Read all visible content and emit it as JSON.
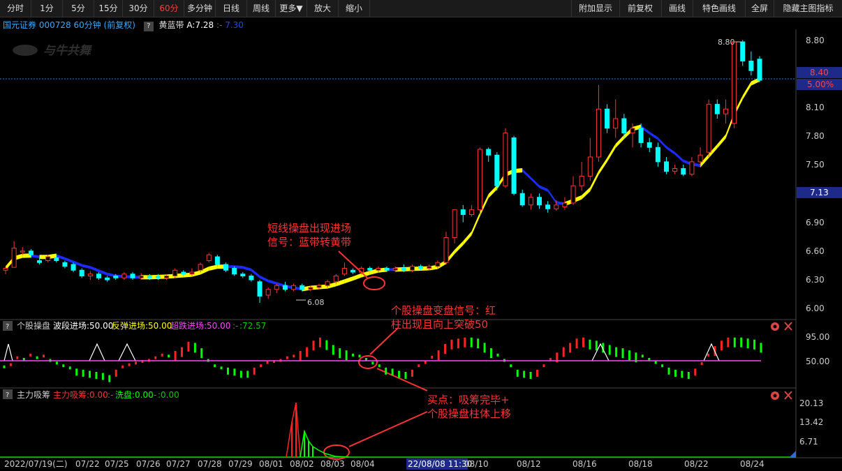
{
  "toolbar": {
    "left": [
      "分时",
      "1分",
      "5分",
      "15分",
      "30分",
      "60分",
      "多分钟",
      "日线",
      "周线",
      "更多▼",
      "放大",
      "缩小"
    ],
    "active": "60分",
    "right": [
      "附加显示",
      "前复权",
      "画线",
      "特色画线",
      "全屏",
      "隐藏主图指标"
    ]
  },
  "header": {
    "stock": "国元证券 000728 60分钟 (前复权)",
    "indicator": "黄蓝带",
    "ind_val": "A:7.28",
    "ind_dots": ":-",
    "ind_val2": "7.30"
  },
  "watermark": "与牛共舞",
  "main_axis": [
    "8.80",
    "8.10",
    "7.80",
    "7.50",
    "6.90",
    "6.60",
    "6.30",
    "6.00"
  ],
  "price_tags": {
    "last": "8.40",
    "pct": "5.00%",
    "yellow": "7.13"
  },
  "labels": {
    "high": "8.80",
    "low": "6.08"
  },
  "annotations": {
    "a1_l1": "短线操盘出现进场",
    "a1_l2": "信号：蓝带转黄带",
    "a2_l1": "个股操盘变盘信号：红",
    "a2_l2": "柱出现且向上突破50",
    "a3_l1": "买点：吸筹完毕+",
    "a3_l2": "个股操盘柱体上移"
  },
  "sub1": {
    "name": "个股操盘",
    "items": [
      {
        "text": "波段进场:50.00",
        "color": "#ffffff"
      },
      {
        "text": "反弹进场:50.00",
        "color": "#ffff00"
      },
      {
        "text": "超跌进场:50.00",
        "color": "#ff44ff"
      },
      {
        "text": ":-",
        "color": "#777777"
      },
      {
        "text": ":72.57",
        "color": "#00cc00"
      }
    ],
    "axis": [
      "95.00",
      "50.00"
    ]
  },
  "sub2": {
    "name": "主力吸筹",
    "items": [
      {
        "text": "主力吸筹:0.00",
        "color": "#ff3333"
      },
      {
        "text": ":-",
        "color": "#777777"
      },
      {
        "text": "洗盘:0.00",
        "color": "#00ff00"
      },
      {
        "text": ":-",
        "color": "#777777"
      },
      {
        "text": ":0.00",
        "color": "#00cc00"
      }
    ],
    "axis": [
      "20.13",
      "13.42",
      "6.71"
    ]
  },
  "dates": [
    "2022/07/19(二)",
    "07/22",
    "07/25",
    "07/26",
    "07/27",
    "07/28",
    "07/29",
    "08/01",
    "08/02",
    "08/03",
    "08/04",
    "22/08/08 11:30",
    "08/10",
    "08/12",
    "08/16",
    "08/18",
    "08/22",
    "08/24"
  ],
  "chart_data": {
    "type": "candlestick",
    "candles": [
      [
        6.42,
        6.44,
        6.38,
        6.46
      ],
      [
        6.45,
        6.65,
        6.62,
        6.72
      ],
      [
        6.62,
        6.62,
        6.58,
        6.66
      ],
      [
        6.62,
        6.58,
        6.55,
        6.64
      ],
      [
        6.52,
        6.5,
        6.48,
        6.55
      ],
      [
        6.52,
        6.56,
        6.5,
        6.58
      ],
      [
        6.55,
        6.52,
        6.5,
        6.58
      ],
      [
        6.5,
        6.46,
        6.44,
        6.52
      ],
      [
        6.48,
        6.42,
        6.4,
        6.5
      ],
      [
        6.42,
        6.36,
        6.34,
        6.44
      ],
      [
        6.36,
        6.38,
        6.32,
        6.41
      ],
      [
        6.38,
        6.34,
        6.32,
        6.4
      ],
      [
        6.34,
        6.32,
        6.3,
        6.36
      ],
      [
        6.36,
        6.34,
        6.32,
        6.38
      ],
      [
        6.34,
        6.38,
        6.32,
        6.4
      ],
      [
        6.38,
        6.34,
        6.32,
        6.4
      ],
      [
        6.34,
        6.36,
        6.32,
        6.39
      ],
      [
        6.36,
        6.34,
        6.32,
        6.38
      ],
      [
        6.36,
        6.34,
        6.32,
        6.38
      ],
      [
        6.34,
        6.36,
        6.32,
        6.38
      ],
      [
        6.36,
        6.42,
        6.34,
        6.44
      ],
      [
        6.4,
        6.38,
        6.36,
        6.42
      ],
      [
        6.38,
        6.4,
        6.36,
        6.44
      ],
      [
        6.42,
        6.48,
        6.4,
        6.5
      ],
      [
        6.52,
        6.58,
        6.5,
        6.6
      ],
      [
        6.56,
        6.48,
        6.46,
        6.58
      ],
      [
        6.48,
        6.42,
        6.4,
        6.5
      ],
      [
        6.44,
        6.38,
        6.36,
        6.46
      ],
      [
        6.38,
        6.36,
        6.34,
        6.4
      ],
      [
        6.36,
        6.32,
        6.3,
        6.38
      ],
      [
        6.3,
        6.15,
        6.08,
        6.32
      ],
      [
        6.16,
        6.22,
        6.12,
        6.24
      ],
      [
        6.22,
        6.26,
        6.18,
        6.28
      ],
      [
        6.26,
        6.22,
        6.2,
        6.3
      ],
      [
        6.22,
        6.26,
        6.2,
        6.28
      ],
      [
        6.26,
        6.22,
        6.2,
        6.28
      ],
      [
        6.22,
        6.24,
        6.2,
        6.26
      ],
      [
        6.24,
        6.26,
        6.22,
        6.28
      ],
      [
        6.26,
        6.3,
        6.24,
        6.32
      ],
      [
        6.3,
        6.36,
        6.28,
        6.38
      ],
      [
        6.38,
        6.44,
        6.36,
        6.5
      ],
      [
        6.42,
        6.4,
        6.38,
        6.44
      ],
      [
        6.4,
        6.44,
        6.38,
        6.46
      ],
      [
        6.44,
        6.42,
        6.4,
        6.46
      ],
      [
        6.42,
        6.44,
        6.4,
        6.46
      ],
      [
        6.44,
        6.42,
        6.4,
        6.46
      ],
      [
        6.42,
        6.44,
        6.4,
        6.46
      ],
      [
        6.44,
        6.42,
        6.4,
        6.48
      ],
      [
        6.42,
        6.46,
        6.4,
        6.48
      ],
      [
        6.46,
        6.44,
        6.42,
        6.48
      ],
      [
        6.44,
        6.46,
        6.42,
        6.48
      ],
      [
        6.46,
        6.5,
        6.44,
        6.52
      ],
      [
        6.5,
        6.76,
        6.48,
        6.82
      ],
      [
        6.76,
        7.05,
        6.7,
        7.05
      ],
      [
        7.05,
        7.0,
        6.92,
        7.1
      ],
      [
        7.0,
        7.05,
        6.98,
        7.1
      ],
      [
        7.05,
        7.68,
        7.0,
        7.7
      ],
      [
        7.68,
        7.62,
        7.55,
        7.7
      ],
      [
        7.62,
        7.3,
        7.25,
        7.65
      ],
      [
        7.3,
        7.85,
        7.28,
        7.9
      ],
      [
        7.8,
        7.22,
        7.2,
        7.82
      ],
      [
        7.22,
        7.1,
        7.08,
        7.26
      ],
      [
        7.1,
        7.18,
        7.05,
        7.22
      ],
      [
        7.18,
        7.1,
        7.06,
        7.22
      ],
      [
        7.1,
        7.06,
        7.02,
        7.14
      ],
      [
        7.06,
        7.1,
        7.04,
        7.15
      ],
      [
        7.08,
        7.12,
        7.05,
        7.18
      ],
      [
        7.12,
        7.3,
        7.1,
        7.4
      ],
      [
        7.3,
        7.4,
        7.25,
        7.55
      ],
      [
        7.4,
        7.6,
        7.35,
        7.8
      ],
      [
        7.6,
        8.1,
        7.55,
        8.35
      ],
      [
        8.1,
        7.9,
        7.85,
        8.15
      ],
      [
        7.9,
        8.0,
        7.8,
        8.2
      ],
      [
        8.0,
        7.85,
        7.8,
        8.05
      ],
      [
        7.85,
        7.9,
        7.7,
        7.95
      ],
      [
        7.9,
        7.75,
        7.7,
        7.95
      ],
      [
        7.75,
        7.7,
        7.65,
        7.8
      ],
      [
        7.7,
        7.55,
        7.5,
        7.75
      ],
      [
        7.55,
        7.45,
        7.42,
        7.6
      ],
      [
        7.45,
        7.48,
        7.42,
        7.52
      ],
      [
        7.48,
        7.42,
        7.4,
        7.52
      ],
      [
        7.42,
        7.55,
        7.4,
        7.6
      ],
      [
        7.55,
        7.62,
        7.5,
        7.7
      ],
      [
        7.65,
        8.15,
        7.6,
        8.2
      ],
      [
        8.15,
        8.05,
        8.0,
        8.2
      ],
      [
        8.05,
        8.1,
        7.95,
        8.2
      ],
      [
        7.95,
        8.8,
        7.9,
        8.8
      ],
      [
        8.8,
        8.6,
        8.55,
        8.82
      ],
      [
        8.6,
        8.5,
        8.45,
        8.7
      ],
      [
        8.62,
        8.4,
        8.38,
        8.65
      ]
    ],
    "score": [
      38,
      42,
      55,
      52,
      60,
      55,
      58,
      50,
      45,
      40,
      36,
      32,
      30,
      28,
      26,
      24,
      20,
      30,
      38,
      42,
      45,
      48,
      50,
      55,
      60,
      58,
      65,
      72,
      82,
      80,
      70,
      50,
      40,
      36,
      34,
      32,
      28,
      28,
      34,
      40,
      46,
      48,
      50,
      55,
      58,
      65,
      72,
      84,
      90,
      85,
      76,
      70,
      66,
      60,
      58,
      52,
      45,
      40,
      34,
      32,
      28,
      26,
      30,
      40,
      46,
      56,
      66,
      78,
      86,
      88,
      90,
      90,
      88,
      80,
      70,
      60,
      50,
      40,
      30,
      28,
      26,
      30,
      40,
      52,
      62,
      72,
      80,
      88,
      90,
      86,
      84,
      80,
      76,
      72,
      70,
      66,
      62,
      58,
      52,
      46,
      40,
      34,
      30,
      28,
      26,
      32,
      44,
      60,
      74,
      84,
      90,
      90,
      90,
      88,
      86,
      80
    ]
  }
}
